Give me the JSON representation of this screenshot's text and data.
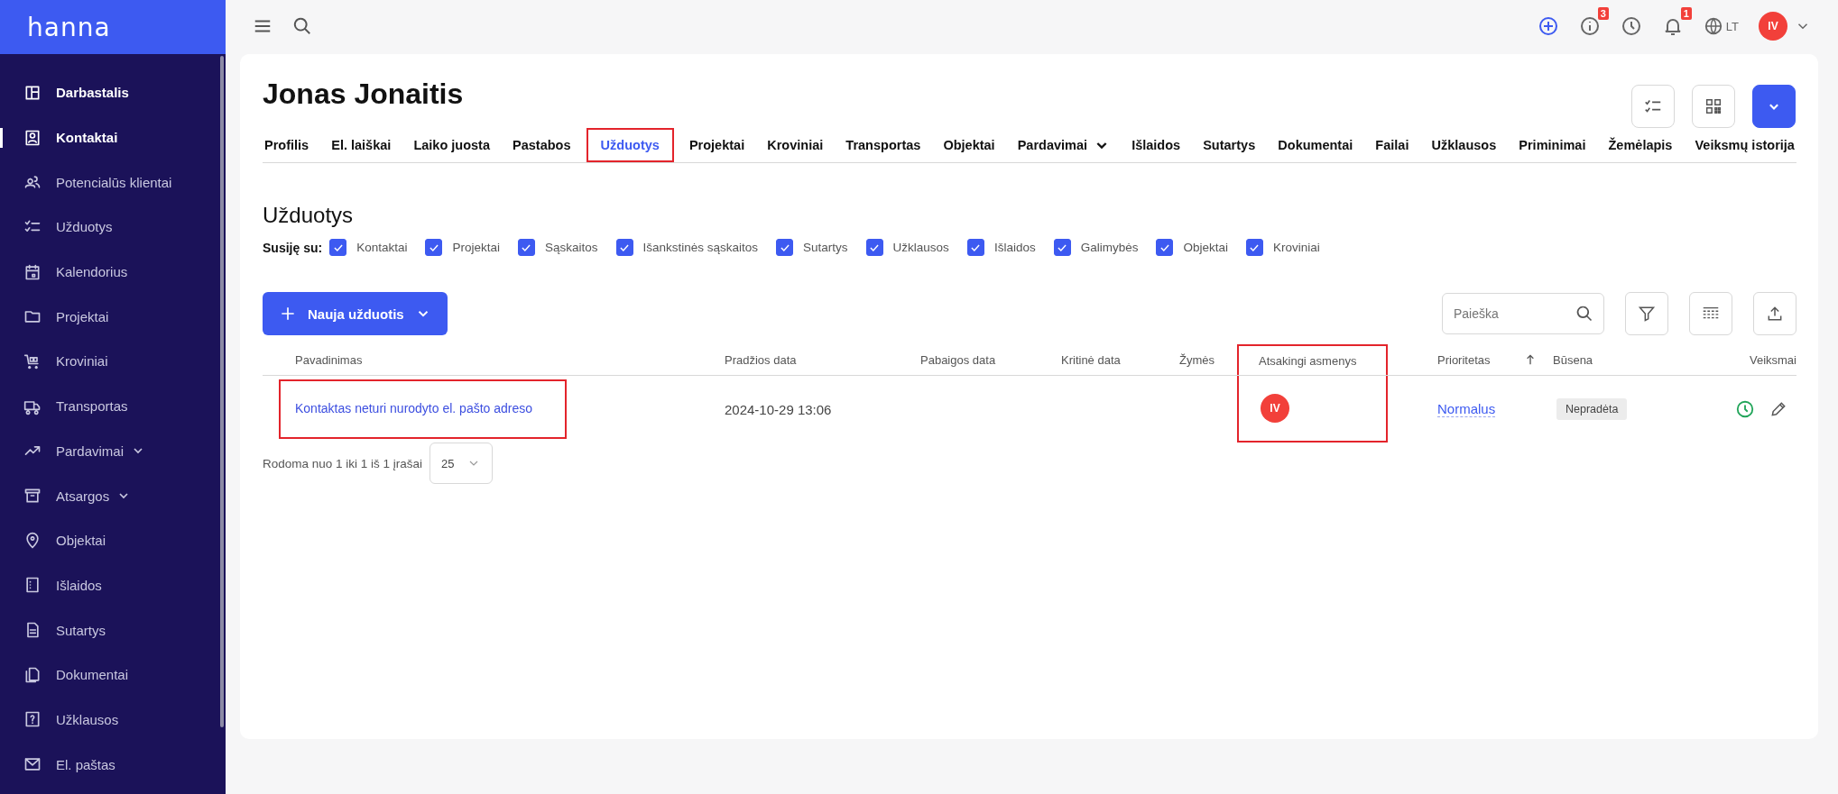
{
  "sidebar": {
    "logo": "hanna",
    "items": [
      {
        "label": "Darbastalis",
        "active": true,
        "selected": false,
        "has_submenu": false
      },
      {
        "label": "Kontaktai",
        "active": true,
        "selected": true,
        "has_submenu": false
      },
      {
        "label": "Potencialūs klientai",
        "active": false,
        "selected": false,
        "has_submenu": false
      },
      {
        "label": "Užduotys",
        "active": false,
        "selected": false,
        "has_submenu": false
      },
      {
        "label": "Kalendorius",
        "active": false,
        "selected": false,
        "has_submenu": false
      },
      {
        "label": "Projektai",
        "active": false,
        "selected": false,
        "has_submenu": false
      },
      {
        "label": "Kroviniai",
        "active": false,
        "selected": false,
        "has_submenu": false
      },
      {
        "label": "Transportas",
        "active": false,
        "selected": false,
        "has_submenu": false
      },
      {
        "label": "Pardavimai",
        "active": false,
        "selected": false,
        "has_submenu": true
      },
      {
        "label": "Atsargos",
        "active": false,
        "selected": false,
        "has_submenu": true
      },
      {
        "label": "Objektai",
        "active": false,
        "selected": false,
        "has_submenu": false
      },
      {
        "label": "Išlaidos",
        "active": false,
        "selected": false,
        "has_submenu": false
      },
      {
        "label": "Sutartys",
        "active": false,
        "selected": false,
        "has_submenu": false
      },
      {
        "label": "Dokumentai",
        "active": false,
        "selected": false,
        "has_submenu": false
      },
      {
        "label": "Užklausos",
        "active": false,
        "selected": false,
        "has_submenu": false
      },
      {
        "label": "El. paštas",
        "active": false,
        "selected": false,
        "has_submenu": false
      }
    ]
  },
  "topbar": {
    "info_badge": "3",
    "notification_badge": "1",
    "language": "LT",
    "user_initials": "IV"
  },
  "contact": {
    "name": "Jonas Jonaitis"
  },
  "tabs": [
    {
      "label": "Profilis",
      "selected": false,
      "highlighted": false,
      "has_submenu": false
    },
    {
      "label": "El. laiškai",
      "selected": false,
      "highlighted": false,
      "has_submenu": false
    },
    {
      "label": "Laiko juosta",
      "selected": false,
      "highlighted": false,
      "has_submenu": false
    },
    {
      "label": "Pastabos",
      "selected": false,
      "highlighted": false,
      "has_submenu": false
    },
    {
      "label": "Užduotys",
      "selected": true,
      "highlighted": true,
      "has_submenu": false
    },
    {
      "label": "Projektai",
      "selected": false,
      "highlighted": false,
      "has_submenu": false
    },
    {
      "label": "Kroviniai",
      "selected": false,
      "highlighted": false,
      "has_submenu": false
    },
    {
      "label": "Transportas",
      "selected": false,
      "highlighted": false,
      "has_submenu": false
    },
    {
      "label": "Objektai",
      "selected": false,
      "highlighted": false,
      "has_submenu": false
    },
    {
      "label": "Pardavimai",
      "selected": false,
      "highlighted": false,
      "has_submenu": true
    },
    {
      "label": "Išlaidos",
      "selected": false,
      "highlighted": false,
      "has_submenu": false
    },
    {
      "label": "Sutartys",
      "selected": false,
      "highlighted": false,
      "has_submenu": false
    },
    {
      "label": "Dokumentai",
      "selected": false,
      "highlighted": false,
      "has_submenu": false
    },
    {
      "label": "Failai",
      "selected": false,
      "highlighted": false,
      "has_submenu": false
    },
    {
      "label": "Užklausos",
      "selected": false,
      "highlighted": false,
      "has_submenu": false
    },
    {
      "label": "Priminimai",
      "selected": false,
      "highlighted": false,
      "has_submenu": false
    },
    {
      "label": "Žemėlapis",
      "selected": false,
      "highlighted": false,
      "has_submenu": false
    },
    {
      "label": "Veiksmų istorija",
      "selected": false,
      "highlighted": false,
      "has_submenu": false
    }
  ],
  "section": {
    "title": "Užduotys",
    "filter_label": "Susiję su:",
    "filters": [
      {
        "label": "Kontaktai",
        "checked": true
      },
      {
        "label": "Projektai",
        "checked": true
      },
      {
        "label": "Sąskaitos",
        "checked": true
      },
      {
        "label": "Išankstinės sąskaitos",
        "checked": true
      },
      {
        "label": "Sutartys",
        "checked": true
      },
      {
        "label": "Užklausos",
        "checked": true
      },
      {
        "label": "Išlaidos",
        "checked": true
      },
      {
        "label": "Galimybės",
        "checked": true
      },
      {
        "label": "Objektai",
        "checked": true
      },
      {
        "label": "Kroviniai",
        "checked": true
      }
    ],
    "new_button": "Nauja užduotis",
    "search": {
      "placeholder": "Paieška"
    }
  },
  "table": {
    "columns": [
      {
        "label": "Pavadinimas",
        "highlighted": false,
        "sorted": false
      },
      {
        "label": "Pradžios data",
        "highlighted": false,
        "sorted": false
      },
      {
        "label": "Pabaigos data",
        "highlighted": false,
        "sorted": false
      },
      {
        "label": "Kritinė data",
        "highlighted": false,
        "sorted": false
      },
      {
        "label": "Žymės",
        "highlighted": false,
        "sorted": false
      },
      {
        "label": "Atsakingi asmenys",
        "highlighted": true,
        "sorted": false
      },
      {
        "label": "Prioritetas",
        "highlighted": false,
        "sorted": true
      },
      {
        "label": "Būsena",
        "highlighted": false,
        "sorted": false
      },
      {
        "label": "Veiksmai",
        "highlighted": false,
        "sorted": false
      }
    ],
    "rows": [
      {
        "title": "Kontaktas neturi nurodyto el. pašto adreso",
        "title_highlighted": true,
        "start_date": "2024-10-29 13:06",
        "responsible": "IV",
        "priority": "Normalus",
        "status": "Nepradėta"
      }
    ],
    "footer": {
      "summary": "Rodoma nuo 1 iki 1 iš 1 įrašai",
      "page_size": "25"
    }
  }
}
